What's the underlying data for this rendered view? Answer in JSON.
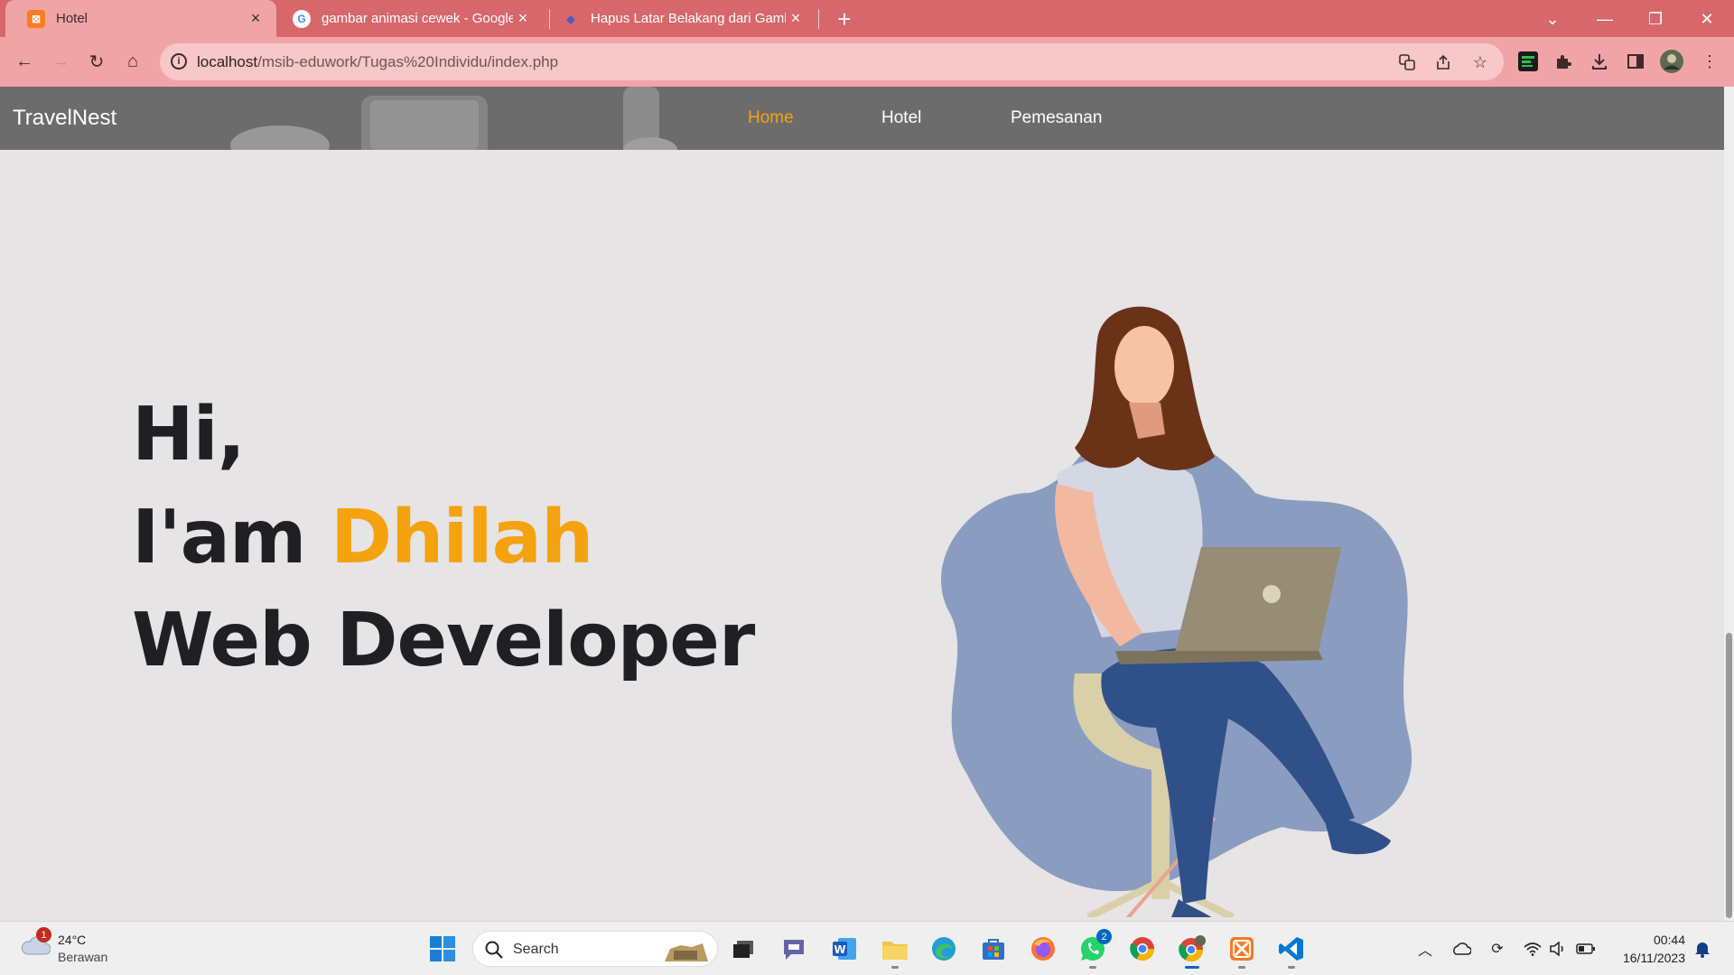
{
  "browser": {
    "tabs": [
      {
        "title": "Hotel",
        "active": true
      },
      {
        "title": "gambar animasi cewek - Google",
        "active": false
      },
      {
        "title": "Hapus Latar Belakang dari Gamb",
        "active": false
      }
    ],
    "url_host": "localhost",
    "url_path": "/msib-eduwork/Tugas%20Individu/index.php"
  },
  "site": {
    "brand": "TravelNest",
    "nav": [
      "Home",
      "Hotel",
      "Pemesanan"
    ],
    "hero": {
      "line1": "Hi,",
      "line2_prefix": "I'am ",
      "line2_name": "Dhilah",
      "line3": "Web Developer"
    },
    "colors": {
      "accent": "#f5a20f",
      "navbar": "#6d6c6d",
      "background": "#e6e4e5",
      "blob": "#8a9cc0"
    }
  },
  "taskbar": {
    "weather_temp": "24°C",
    "weather_cond": "Berawan",
    "weather_badge": "1",
    "search_label": "Search",
    "whatsapp_badge": "2",
    "time": "00:44",
    "date": "16/11/2023"
  }
}
